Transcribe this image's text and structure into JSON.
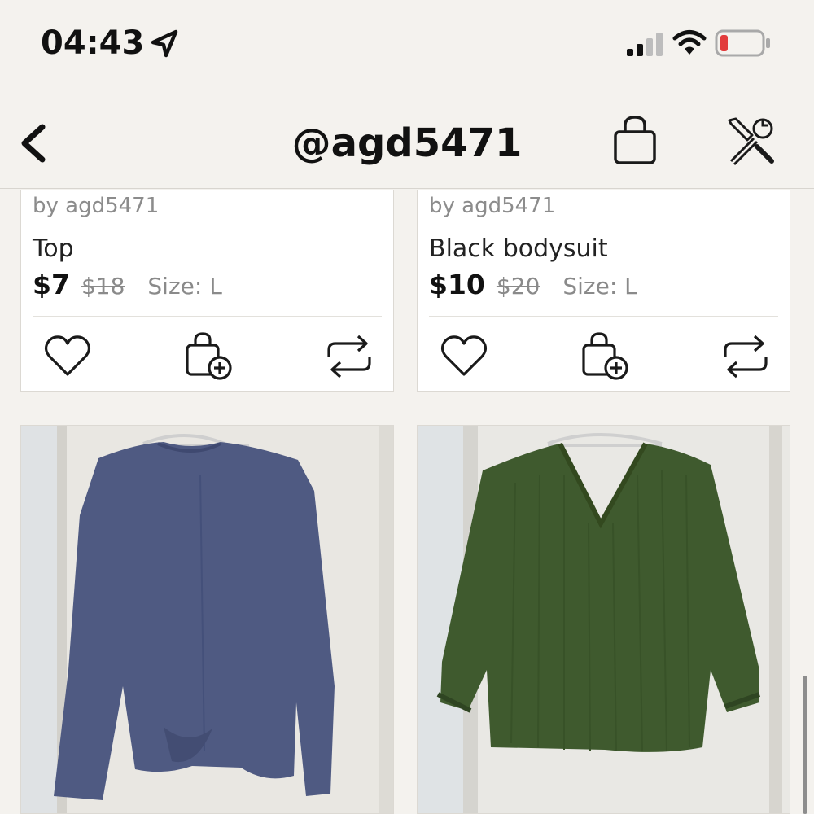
{
  "status_bar": {
    "time": "04:43",
    "icons": [
      "location-arrow-icon",
      "signal-icon",
      "wifi-icon",
      "battery-icon"
    ],
    "battery_color": "#e23b3b"
  },
  "nav": {
    "title": "@agd5471",
    "back_icon": "chevron-left-icon",
    "bag_icon": "shopping-bag-icon",
    "tools_icon": "wrench-screwdriver-icon"
  },
  "listings": [
    {
      "by": "by agd5471",
      "title": "Top",
      "price": "$7",
      "original_price": "$18",
      "size": "Size: L"
    },
    {
      "by": "by agd5471",
      "title": "Black bodysuit",
      "price": "$10",
      "original_price": "$20",
      "size": "Size: L"
    }
  ],
  "actions": [
    "heart-icon",
    "add-to-bag-icon",
    "repost-icon"
  ],
  "photos": [
    {
      "item": "blue-long-sleeve-top",
      "color": "#4f5a82"
    },
    {
      "item": "green-v-neck-blouse",
      "color": "#3f5a2e"
    }
  ],
  "colors": {
    "background": "#f4f2ee",
    "card": "#ffffff",
    "muted_text": "#8a8a8a"
  }
}
